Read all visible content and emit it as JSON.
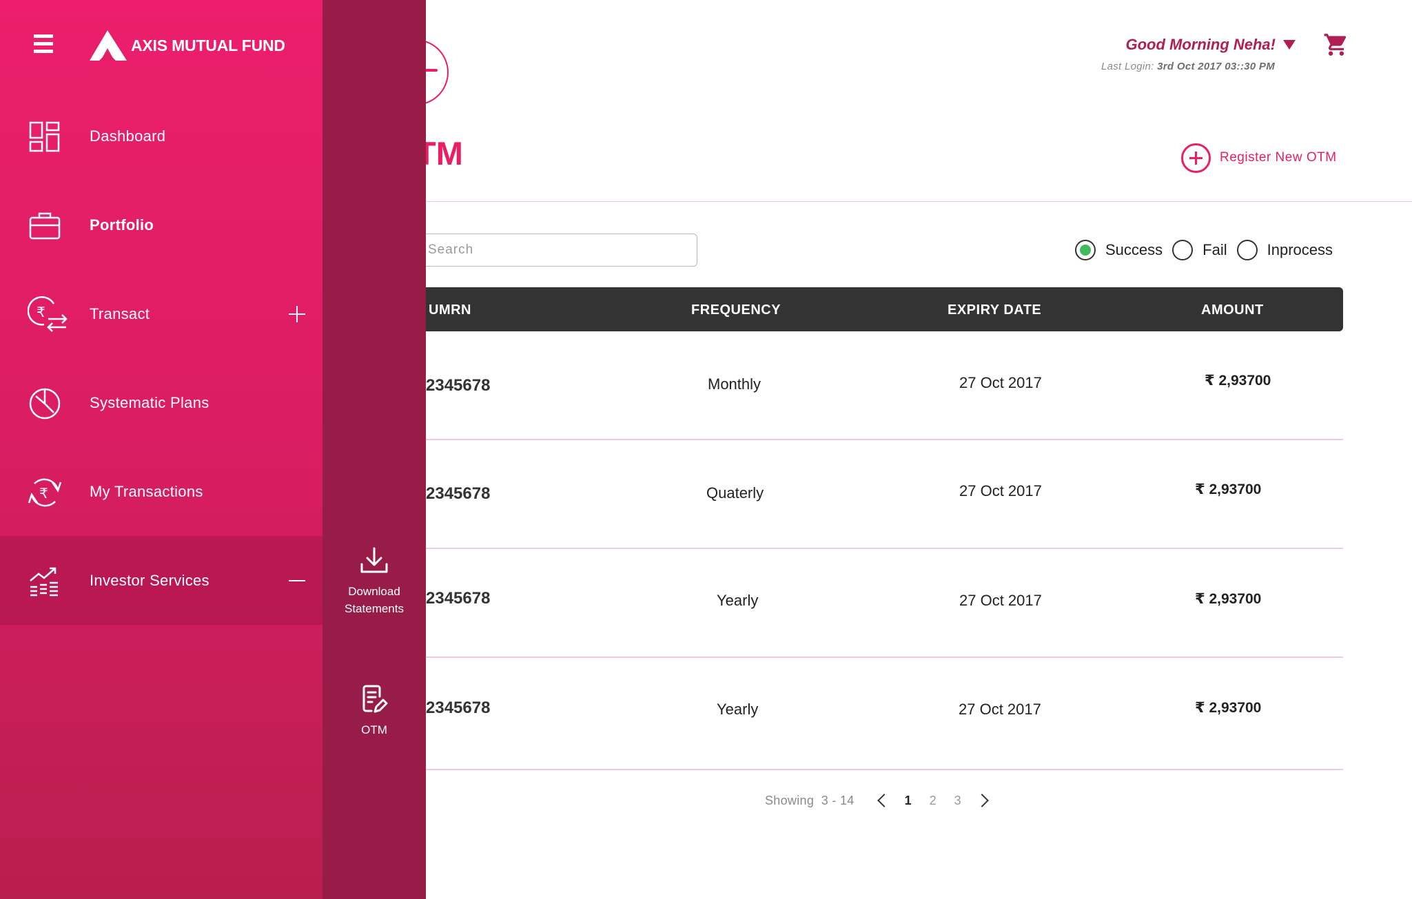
{
  "app": {
    "brand": "AXIS MUTUAL FUND"
  },
  "sidebar": {
    "items": [
      {
        "label": "Dashboard",
        "icon": "dashboard-icon"
      },
      {
        "label": "Portfolio",
        "icon": "briefcase-icon"
      },
      {
        "label": "Transact",
        "icon": "rupee-exchange-icon"
      },
      {
        "label": "Systematic Plans",
        "icon": "pie-chart-icon"
      },
      {
        "label": "My Transactions",
        "icon": "rupee-refresh-icon"
      },
      {
        "label": "Investor Services",
        "icon": "growth-chart-icon"
      }
    ]
  },
  "submenu": {
    "items": [
      {
        "label": "Download Statements",
        "icon": "download-icon"
      },
      {
        "label": "OTM",
        "icon": "edit-document-icon"
      }
    ]
  },
  "header": {
    "greeting": "Good Morning Neha!",
    "last_login_label": "Last Login:",
    "last_login_value": "3rd Oct 2017 03::30 PM"
  },
  "page": {
    "title": "TM",
    "register_label": "Register New OTM"
  },
  "search": {
    "placeholder": "Search"
  },
  "filters": [
    {
      "label": "Success",
      "checked": true
    },
    {
      "label": "Fail",
      "checked": false
    },
    {
      "label": "Inprocess",
      "checked": false
    }
  ],
  "table": {
    "columns": [
      "UMRN",
      "FREQUENCY",
      "EXPIRY DATE",
      "AMOUNT"
    ],
    "rows": [
      {
        "umrn": "2345678",
        "frequency": "Monthly",
        "expiry": "27 Oct 2017",
        "amount": "₹ 2,93700"
      },
      {
        "umrn": "2345678",
        "frequency": "Quaterly",
        "expiry": "27 Oct 2017",
        "amount": "₹ 2,93700"
      },
      {
        "umrn": "2345678",
        "frequency": "Yearly",
        "expiry": "27 Oct 2017",
        "amount": "₹ 2,93700"
      },
      {
        "umrn": "2345678",
        "frequency": "Yearly",
        "expiry": "27 Oct 2017",
        "amount": "₹ 2,93700"
      }
    ]
  },
  "pagination": {
    "showing_label": "Showing",
    "range": "3 - 14",
    "pages": [
      "1",
      "2",
      "3"
    ],
    "current": "1"
  },
  "colors": {
    "brand_pink": "#ec1e6d",
    "submenu_bg": "#971c47",
    "table_header": "#333333",
    "success_green": "#3dbb5d"
  }
}
